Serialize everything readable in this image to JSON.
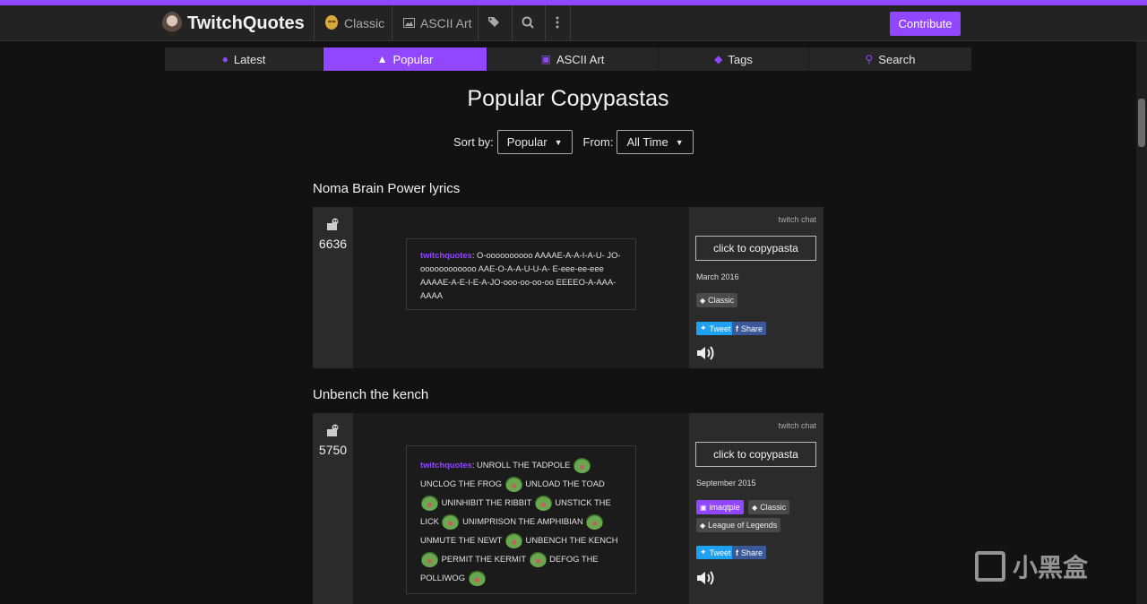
{
  "brand": {
    "name": "TwitchQuotes"
  },
  "navbar": {
    "items": [
      {
        "label": "Classic",
        "icon": "kappa-icon"
      },
      {
        "label": "ASCII Art",
        "icon": "image-icon"
      },
      {
        "label": "",
        "icon": "tags-icon"
      },
      {
        "label": "",
        "icon": "search-icon"
      },
      {
        "label": "",
        "icon": "more-vertical-icon"
      }
    ],
    "contribute_label": "Contribute"
  },
  "subnav": {
    "tabs": [
      {
        "label": "Latest",
        "icon": "comment-icon",
        "active": false
      },
      {
        "label": "Popular",
        "icon": "fire-icon",
        "active": true
      },
      {
        "label": "ASCII Art",
        "icon": "image-icon",
        "active": false
      },
      {
        "label": "Tags",
        "icon": "tags-icon",
        "active": false
      },
      {
        "label": "Search",
        "icon": "search-icon",
        "active": false
      }
    ]
  },
  "page": {
    "title": "Popular Copypastas",
    "sort_label": "Sort by:",
    "sort_value": "Popular",
    "from_label": "From:",
    "from_value": "All Time"
  },
  "quotes": [
    {
      "title": "Noma Brain Power lyrics",
      "votes": "6636",
      "source_label": "twitch chat",
      "copy_label": "click to copypasta",
      "date": "March 2016",
      "user": "twitchquotes",
      "text": "O-oooooooooo AAAAE-A-A-I-A-U- JO-oooooooooooo AAE-O-A-A-U-U-A- E-eee-ee-eee AAAAE-A-E-I-E-A-JO-ooo-oo-oo-oo EEEEO-A-AAA-AAAA",
      "tags": [
        "Classic"
      ],
      "tweet_label": "Tweet",
      "share_label": "Share"
    },
    {
      "title": "Unbench the kench",
      "votes": "5750",
      "source_label": "twitch chat",
      "copy_label": "click to copypasta",
      "date": "September 2015",
      "user": "twitchquotes",
      "segments": [
        "UNROLL THE TADPOLE",
        "UNCLOG THE FROG",
        "UNLOAD THE TOAD",
        "UNINHIBIT THE RIBBIT",
        "UNSTICK THE LICK",
        "UNIMPRISON THE AMPHIBIAN",
        "UNMUTE THE NEWT",
        "UNBENCH THE KENCH",
        "PERMIT THE KERMIT",
        "DEFOG THE POLLIWOG"
      ],
      "emote": "frog-emote-icon",
      "streamer_badge": "imaqtpie",
      "tags": [
        "Classic",
        "League of Legends"
      ],
      "tweet_label": "Tweet",
      "share_label": "Share"
    }
  ],
  "watermark": {
    "text": "小黑盒"
  },
  "colors": {
    "accent": "#9146ff",
    "background": "#121212",
    "panel": "#2b2b2b",
    "twitter": "#1da1f2",
    "facebook": "#3b5998"
  }
}
